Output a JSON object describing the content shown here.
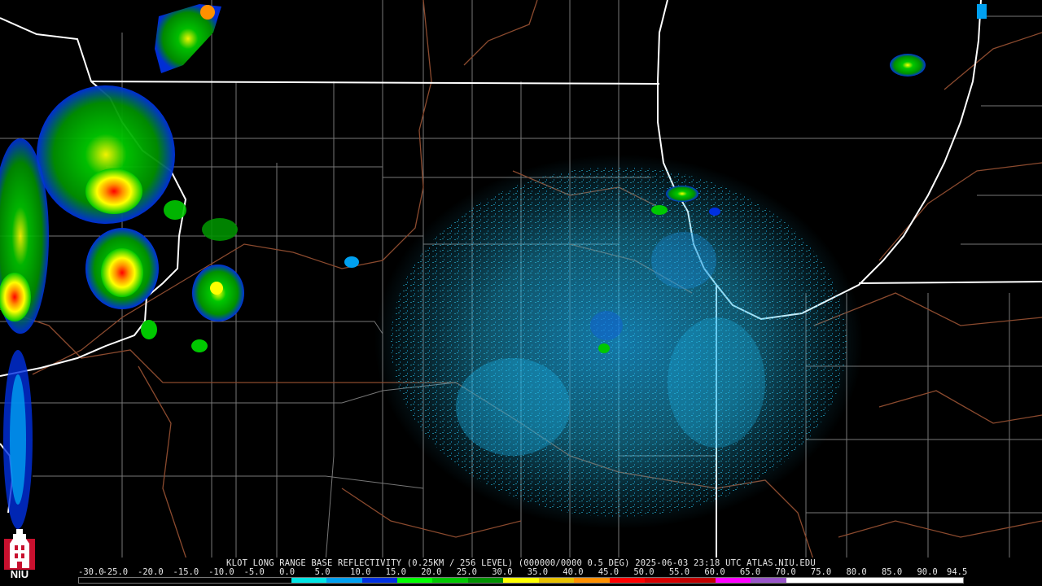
{
  "caption": "KLOT LONG RANGE BASE REFLECTIVITY (0.25KM / 256 LEVEL) (000000/0000 0.5 DEG) 2025-06-03 23:18 UTC  ATLAS.NIU.EDU",
  "logo": {
    "text": "NIU",
    "icon": "niu-tower-icon"
  },
  "scale": {
    "labels": [
      "-30.0",
      "-25.0",
      "-20.0",
      "-15.0",
      "-10.0",
      "-5.0",
      "0.0",
      "5.0",
      "10.0",
      "15.0",
      "20.0",
      "25.0",
      "30.0",
      "35.0",
      "40.0",
      "45.0",
      "50.0",
      "55.0",
      "60.0",
      "65.0",
      "70.0",
      "75.0",
      "80.0",
      "85.0",
      "90.0",
      "94.5"
    ],
    "colors": [
      "#000000",
      "#000000",
      "#000000",
      "#000000",
      "#000000",
      "#000000",
      "#00e5e5",
      "#00a0f0",
      "#0030e0",
      "#00ff00",
      "#00c800",
      "#009000",
      "#ffff00",
      "#e7c000",
      "#ff9000",
      "#ff0000",
      "#d60000",
      "#c00000",
      "#ff00ff",
      "#9955c9",
      "#ffffff",
      "#ffffff",
      "#ffffff",
      "#ffffff",
      "#ffffff"
    ]
  },
  "palette": {
    "background": "#000000",
    "state_border": "#ffffff",
    "county_border": "#777777",
    "river": "#8b4a2e"
  }
}
